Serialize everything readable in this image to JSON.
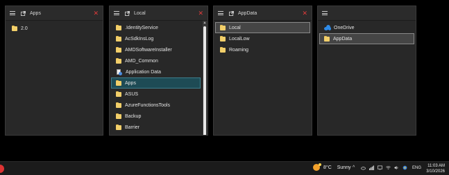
{
  "panes": [
    {
      "title": "Apps",
      "items": [
        {
          "label": "2.0",
          "icon": "folder-icon"
        }
      ]
    },
    {
      "title": "Local",
      "items": [
        {
          "label": ".IdentityService",
          "icon": "folder-icon"
        },
        {
          "label": "AcSdkInsLog",
          "icon": "folder-icon"
        },
        {
          "label": "AMDSoftwareInstaller",
          "icon": "folder-icon"
        },
        {
          "label": "AMD_Common",
          "icon": "folder-icon"
        },
        {
          "label": "Application Data",
          "icon": "appdata-icon"
        },
        {
          "label": "Apps",
          "icon": "folder-icon",
          "selected": true
        },
        {
          "label": "ASUS",
          "icon": "folder-icon"
        },
        {
          "label": "AzureFunctionsTools",
          "icon": "folder-icon"
        },
        {
          "label": "Backup",
          "icon": "folder-icon"
        },
        {
          "label": "Barrier",
          "icon": "folder-icon"
        }
      ]
    },
    {
      "title": "AppData",
      "items": [
        {
          "label": "Local",
          "icon": "folder-icon",
          "selected": true
        },
        {
          "label": "LocalLow",
          "icon": "folder-icon"
        },
        {
          "label": "Roaming",
          "icon": "folder-icon"
        }
      ]
    },
    {
      "title": "",
      "items": [
        {
          "label": "OneDrive",
          "icon": "onedrive-icon"
        },
        {
          "label": "AppData",
          "icon": "folder-icon",
          "selected": true
        }
      ]
    }
  ],
  "colors": {
    "background": "#000000",
    "pane": "#282828",
    "selection_teal": "#1e4b55",
    "selection_gray": "#454545",
    "close": "#e23b3b",
    "folder": "#f2cf6a"
  },
  "taskbar": {
    "weather": {
      "temp": "8°C",
      "condition": "Sunny"
    },
    "language": "ENG",
    "time": "11:03 AM",
    "date": "3/10/2026"
  }
}
